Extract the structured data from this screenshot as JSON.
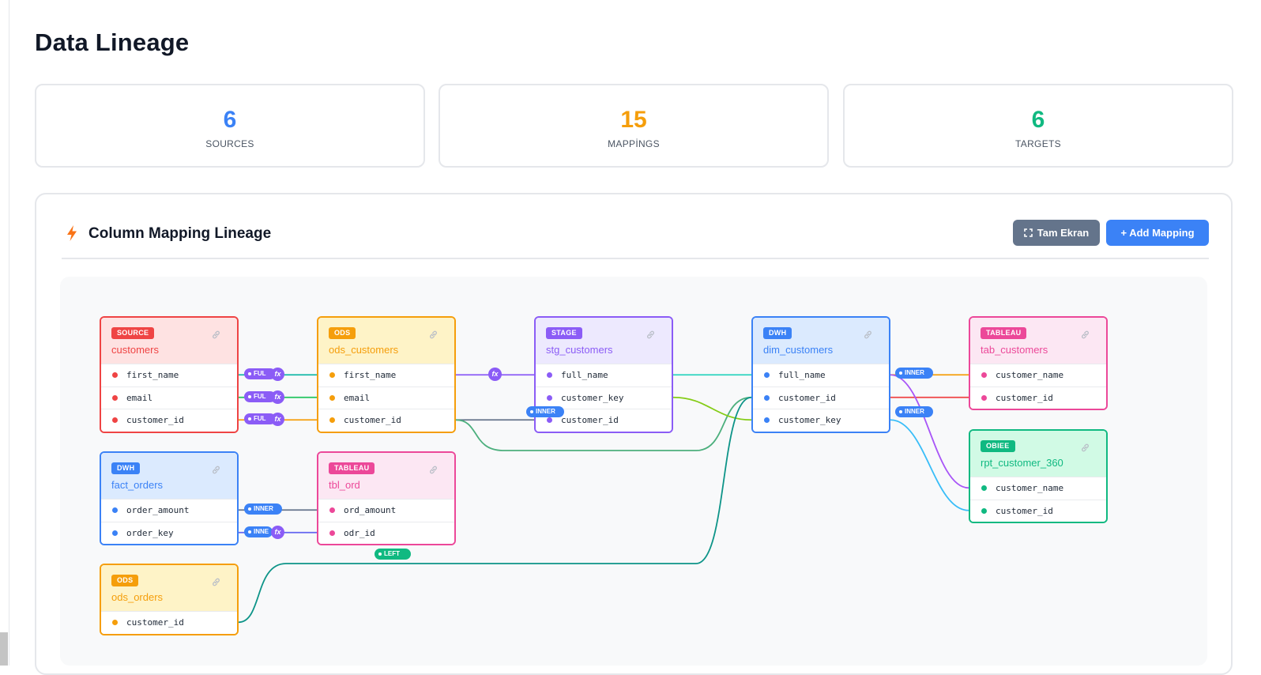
{
  "page": {
    "title": "Data Lineage"
  },
  "stats": [
    {
      "value": "6",
      "label": "SOURCES",
      "color": "#3b82f6"
    },
    {
      "value": "15",
      "label": "MAPPİNGS",
      "color": "#f59e0b"
    },
    {
      "value": "6",
      "label": "TARGETS",
      "color": "#10b981"
    }
  ],
  "panel": {
    "title": "Column Mapping Lineage",
    "title_icon": "bolt-icon",
    "fullscreen_label": "Tam Ekran",
    "fullscreen_icon": "expand-icon",
    "add_label": "+ Add Mapping"
  },
  "nodes": {
    "customers": {
      "badge": "SOURCE",
      "name": "customers",
      "columns": [
        "first_name",
        "email",
        "customer_id"
      ],
      "color": "#ef4444"
    },
    "ods_customers": {
      "badge": "ODS",
      "name": "ods_customers",
      "columns": [
        "first_name",
        "email",
        "customer_id"
      ],
      "color": "#f59e0b"
    },
    "stg_customers": {
      "badge": "STAGE",
      "name": "stg_customers",
      "columns": [
        "full_name",
        "customer_key",
        "customer_id"
      ],
      "color": "#8b5cf6"
    },
    "dim_customers": {
      "badge": "DWH",
      "name": "dim_customers",
      "columns": [
        "full_name",
        "customer_id",
        "customer_key"
      ],
      "color": "#3b82f6"
    },
    "tab_customers": {
      "badge": "TABLEAU",
      "name": "tab_customers",
      "columns": [
        "customer_name",
        "customer_id"
      ],
      "color": "#ec4899"
    },
    "rpt_customer_360": {
      "badge": "OBIEE",
      "name": "rpt_customer_360",
      "columns": [
        "customer_name",
        "customer_id"
      ],
      "color": "#10b981"
    },
    "fact_orders": {
      "badge": "DWH",
      "name": "fact_orders",
      "columns": [
        "order_amount",
        "order_key"
      ],
      "color": "#3b82f6"
    },
    "tbl_ord": {
      "badge": "TABLEAU",
      "name": "tbl_ord",
      "columns": [
        "ord_amount",
        "odr_id"
      ],
      "color": "#ec4899"
    },
    "ods_orders": {
      "badge": "ODS",
      "name": "ods_orders",
      "columns": [
        "customer_id"
      ],
      "color": "#f59e0b"
    }
  },
  "joins": {
    "full": "FUL",
    "inner": "INNER",
    "inner_short": "INNE",
    "left": "LEFT",
    "fx": "fx"
  },
  "icons": {
    "node_link": "link-icon"
  }
}
